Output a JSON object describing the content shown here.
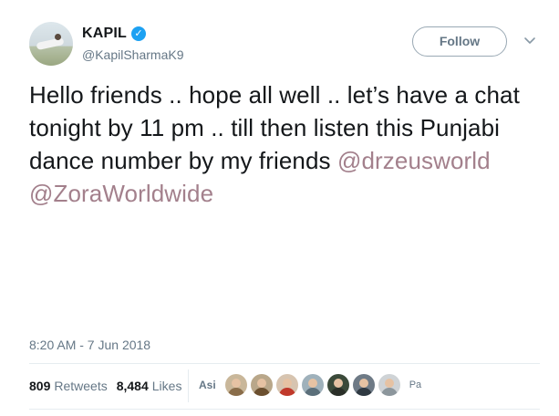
{
  "author": {
    "name": "KAPIL",
    "handle": "@KapilSharmaK9",
    "verified_glyph": "✓",
    "verified_icon": "verified-badge-icon",
    "avatar_icon": "profile-photo"
  },
  "follow_label": "Follow",
  "menu_icon": "chevron-down-icon",
  "tweet": {
    "text": "Hello friends .. hope all well .. let’s have a chat tonight by 11 pm .. till then listen this Punjabi dance number by my friends ",
    "mention1": "@drzeusworld",
    "mention2": "@ZoraWorldwide"
  },
  "timestamp": "8:20 AM - 7 Jun 2018",
  "stats": {
    "retweets_count": "809",
    "retweets_label": "Retweets",
    "likes_count": "8,484",
    "likes_label": "Likes"
  },
  "likers": {
    "start_label": "Asi",
    "end_label": "Pa",
    "faces": [
      {
        "bg": "#c9b79a",
        "body": "#8a6d4a"
      },
      {
        "bg": "#b9a78a",
        "body": "#6b4f2f"
      },
      {
        "bg": "#d7c4b0",
        "body": "#c0392b"
      },
      {
        "bg": "#9fb1bb",
        "body": "#5b6f7a"
      },
      {
        "bg": "#3b4a3a",
        "body": "#2a2f28"
      },
      {
        "bg": "#6e7a86",
        "body": "#2f3942"
      },
      {
        "bg": "#cfd3d6",
        "body": "#8c969c"
      }
    ]
  },
  "colors": {
    "mention": "#a3808c",
    "secondary_text": "#657786",
    "verified_blue": "#1da1f2"
  }
}
